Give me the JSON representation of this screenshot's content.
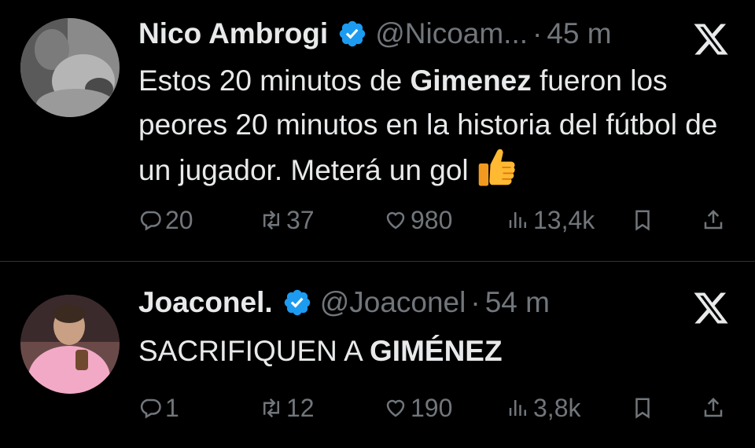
{
  "tweets": [
    {
      "name": "Nico Ambrogi",
      "handle": "@Nicoam...",
      "separator": "·",
      "time": "45 m",
      "text_parts": [
        "Estos 20 minutos de ",
        "Gimenez",
        " fueron los peores 20 minutos en la historia del fútbol de un jugador. Meterá un gol"
      ],
      "emoji": "thumbs-up",
      "replies": "20",
      "retweets": "37",
      "likes": "980",
      "views": "13,4k"
    },
    {
      "name": "Joaconel.",
      "handle": "@Joaconel",
      "separator": "·",
      "time": "54 m",
      "text_parts": [
        "SACRIFIQUEN A ",
        "GIMÉNEZ"
      ],
      "replies": "1",
      "retweets": "12",
      "likes": "190",
      "views": "3,8k"
    }
  ],
  "colors": {
    "background": "#000000",
    "text": "#e7e9ea",
    "muted": "#71767b",
    "verified": "#1d9bf0",
    "divider": "#2f3336"
  },
  "icons": [
    "verified-badge-icon",
    "x-logo-icon",
    "reply-icon",
    "retweet-icon",
    "like-icon",
    "views-icon",
    "bookmark-icon",
    "share-icon"
  ]
}
